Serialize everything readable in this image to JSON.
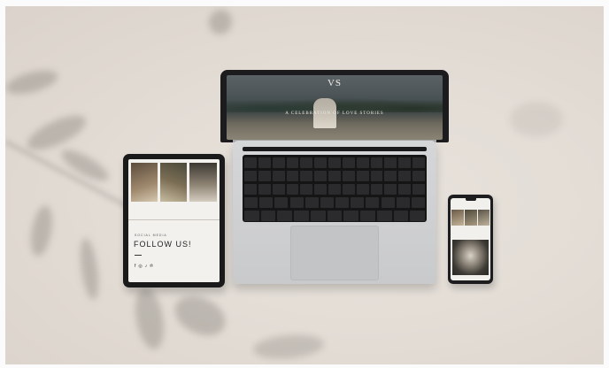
{
  "laptop": {
    "site_logo": "VS",
    "hero_tagline": "A CELEBRATION OF LOVE STORIES"
  },
  "tablet": {
    "eyebrow": "SOCIAL MEDIA",
    "heading": "FOLLOW US!",
    "social_icons": [
      "f",
      "◎",
      "♪",
      "℗"
    ]
  },
  "colors": {
    "background": "#e3ddd6",
    "device_dark": "#1c1c1e",
    "laptop_silver": "#d0d1d3"
  }
}
